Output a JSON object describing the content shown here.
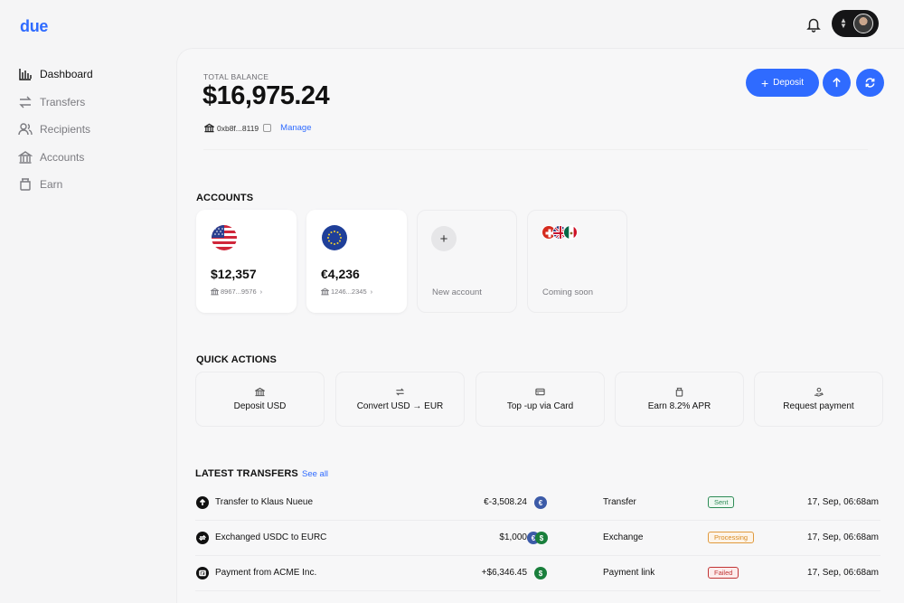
{
  "app": {
    "logo": "due"
  },
  "sidebar": {
    "items": [
      {
        "label": "Dashboard",
        "icon": "bar-chart-icon",
        "active": true
      },
      {
        "label": "Transfers",
        "icon": "arrows-icon",
        "active": false
      },
      {
        "label": "Recipients",
        "icon": "users-icon",
        "active": false
      },
      {
        "label": "Accounts",
        "icon": "bank-icon",
        "active": false
      },
      {
        "label": "Earn",
        "icon": "jar-icon",
        "active": false
      }
    ]
  },
  "balance": {
    "label": "TOTAL BALANCE",
    "value": "$16,975.24",
    "wallet": "0xb8f...8119",
    "manage": "Manage"
  },
  "actions": {
    "deposit": "Deposit"
  },
  "accounts": {
    "title": "ACCOUNTS",
    "cards": [
      {
        "amount": "$12,357",
        "number": "8967...9576",
        "flag": "us-flag-icon"
      },
      {
        "amount": "€4,236",
        "number": "1246...2345",
        "flag": "eu-flag-icon"
      }
    ],
    "new_account": "New account",
    "coming_soon": "Coming soon"
  },
  "quick_actions": {
    "title": "QUICK ACTIONS",
    "items": [
      {
        "label": "Deposit USD",
        "icon": "bank-icon"
      },
      {
        "label": "Convert USD → EUR",
        "icon": "swap-icon"
      },
      {
        "label": "Top -up via Card",
        "icon": "card-icon"
      },
      {
        "label": "Earn 8.2% APR",
        "icon": "jar-icon"
      },
      {
        "label": "Request payment",
        "icon": "hand-coin-icon"
      }
    ]
  },
  "transfers": {
    "title": "LATEST TRANSFERS",
    "see_all": "See all",
    "rows": [
      {
        "desc": "Transfer to Klaus Nueue",
        "amount": "€-3,508.24",
        "currency": [
          "€"
        ],
        "type": "Transfer",
        "status": "Sent",
        "time": "17, Sep, 06:68am"
      },
      {
        "desc": "Exchanged USDC to EURC",
        "amount": "$1,000",
        "currency": [
          "€",
          "$"
        ],
        "type": "Exchange",
        "status": "Processing",
        "time": "17, Sep, 06:68am"
      },
      {
        "desc": "Payment from ACME Inc.",
        "amount": "+$6,346.45",
        "currency": [
          "$"
        ],
        "type": "Payment link",
        "status": "Failed",
        "time": "17, Sep, 06:68am"
      }
    ]
  },
  "colors": {
    "accent": "#2f6bff",
    "sent": "#2e8b57",
    "processing": "#d98a20",
    "failed": "#c23535"
  }
}
